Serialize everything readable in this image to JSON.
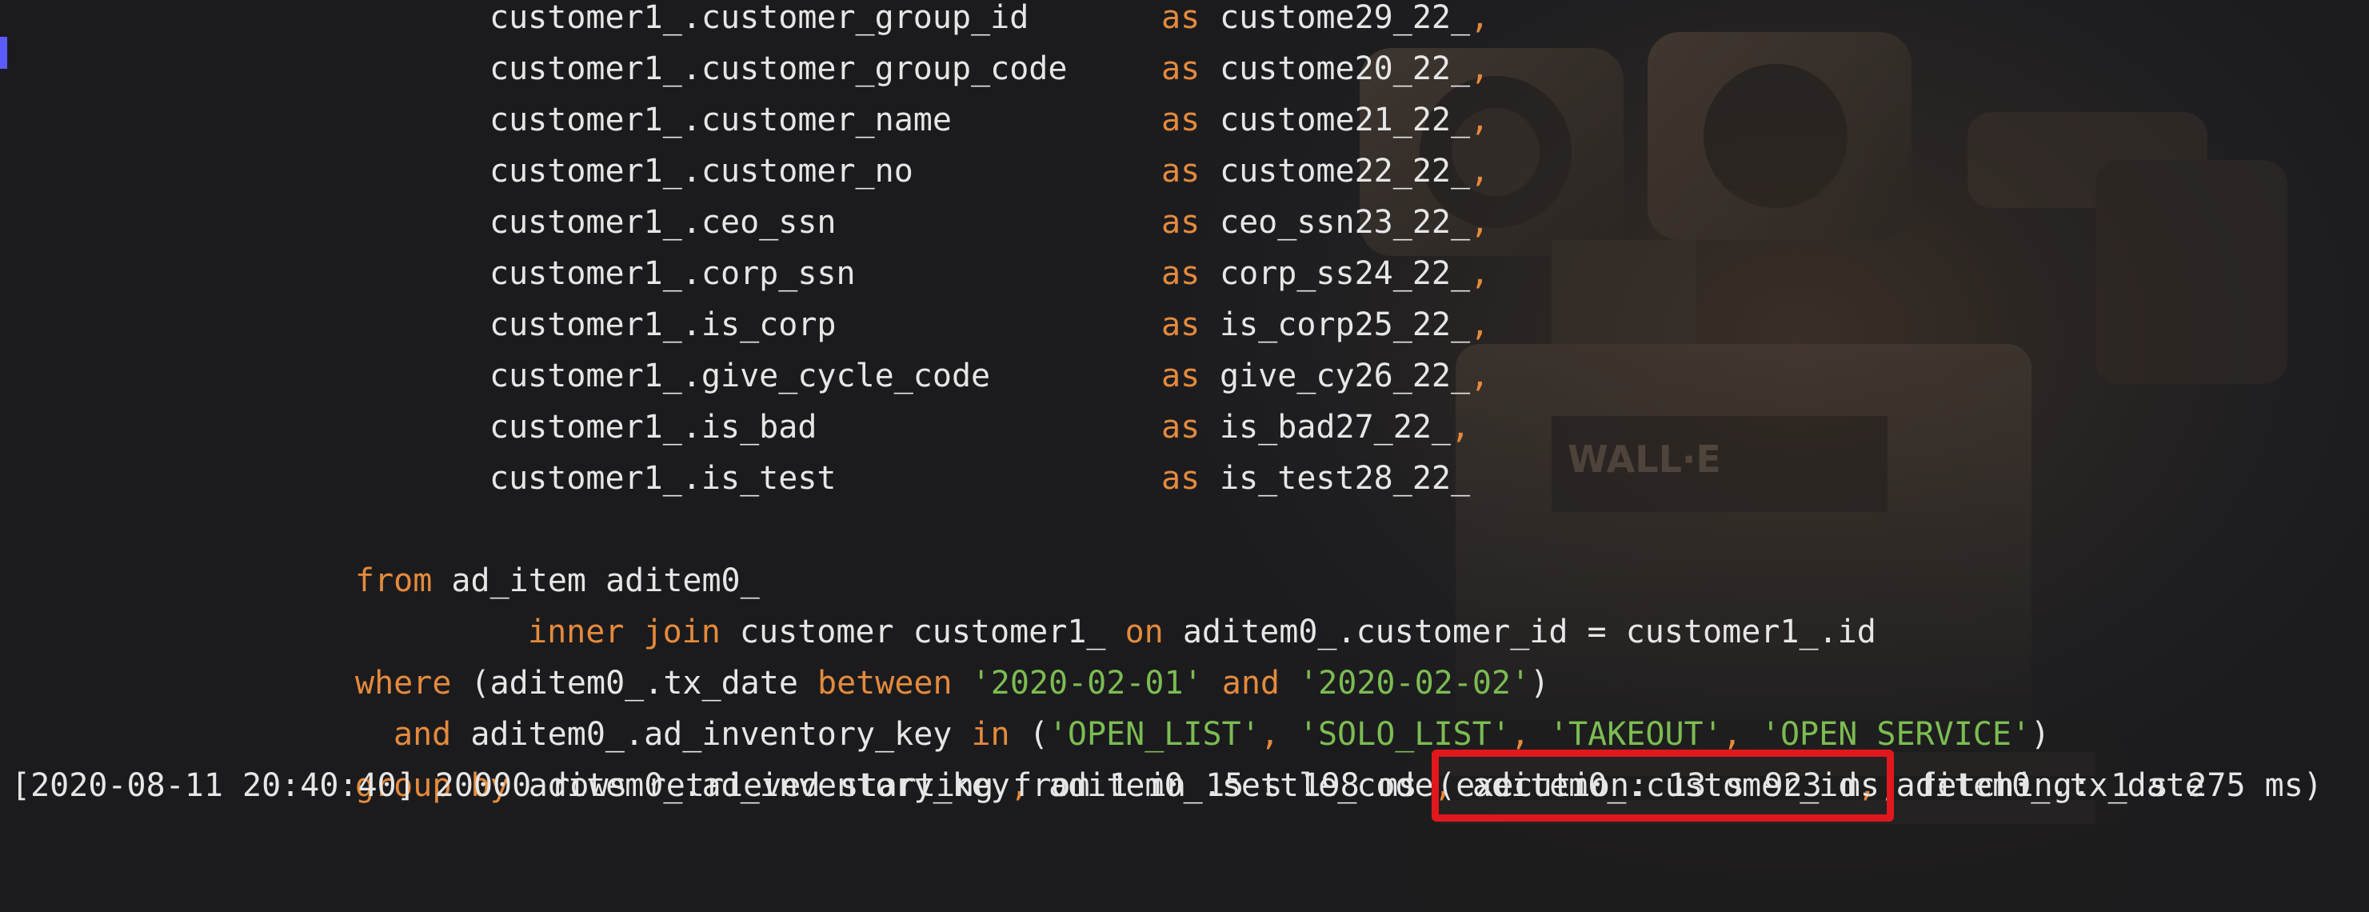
{
  "select_columns": [
    {
      "expr": "customer1_.customer_group_id",
      "as": "as",
      "alias": "custome29_22_",
      "comma": ","
    },
    {
      "expr": "customer1_.customer_group_code",
      "as": "as",
      "alias": "custome20_22_",
      "comma": ","
    },
    {
      "expr": "customer1_.customer_name",
      "as": "as",
      "alias": "custome21_22_",
      "comma": ","
    },
    {
      "expr": "customer1_.customer_no",
      "as": "as",
      "alias": "custome22_22_",
      "comma": ","
    },
    {
      "expr": "customer1_.ceo_ssn",
      "as": "as",
      "alias": "ceo_ssn23_22_",
      "comma": ","
    },
    {
      "expr": "customer1_.corp_ssn",
      "as": "as",
      "alias": "corp_ss24_22_",
      "comma": ","
    },
    {
      "expr": "customer1_.is_corp",
      "as": "as",
      "alias": "is_corp25_22_",
      "comma": ","
    },
    {
      "expr": "customer1_.give_cycle_code",
      "as": "as",
      "alias": "give_cy26_22_",
      "comma": ","
    },
    {
      "expr": "customer1_.is_bad",
      "as": "as",
      "alias": "is_bad27_22_",
      "comma": ","
    },
    {
      "expr": "customer1_.is_test",
      "as": "as",
      "alias": "is_test28_22_",
      "comma": ""
    }
  ],
  "from_clause": {
    "kw": "from",
    "rest": " ad_item aditem0_"
  },
  "join_clause": {
    "kw1": "inner",
    "kw2": "join",
    "mid": " customer customer1_ ",
    "kw3": "on",
    "rest": " aditem0_.customer_id = customer1_.id"
  },
  "where_clause": {
    "kw": "where",
    "part1": " (aditem0_.tx_date ",
    "kw2": "between",
    "str1": "'2020-02-01'",
    "kw3": "and",
    "str2": "'2020-02-02'",
    "close": ")"
  },
  "and_clause": {
    "kw": "and",
    "part1": " aditem0_.ad_inventory_key ",
    "kw2": "in",
    "open": " (",
    "values": [
      "'OPEN_LIST'",
      "'SOLO_LIST'",
      "'TAKEOUT'",
      "'OPEN_SERVICE'"
    ],
    "sep": ", ",
    "close": ")"
  },
  "group_clause": {
    "kw": "group by",
    "cols": [
      "aditem0_.ad_inventory_key",
      "aditem0_.settle_code",
      "aditem0_.customer_id",
      "aditem0_.tx_date"
    ],
    "sep": ","
  },
  "status": {
    "text_before": "[2020-08-11 20:40:40] 20000 rows retrieved starting from 1 in 15 s 198 ms (",
    "highlighted": "execution: 13 s 923 ms,",
    "text_after": " fetching: 1 s 275 ms)"
  },
  "colors": {
    "keyword": "#e48a3c",
    "string": "#7cbc52",
    "text": "#e6e6e6",
    "highlight_border": "#e0181d",
    "background": "#1c1d20"
  }
}
